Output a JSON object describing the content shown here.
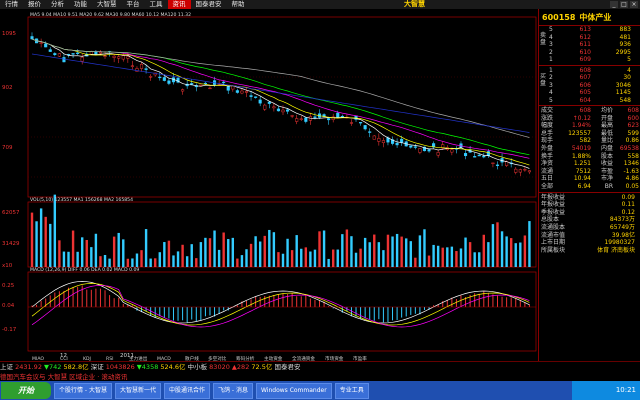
{
  "menu": {
    "items": [
      "行情",
      "报价",
      "分析",
      "功能",
      "大智慧",
      "平台",
      "工具",
      "帮助"
    ],
    "active_item": "资讯",
    "secondary": "国泰君安",
    "brand": "大智慧"
  },
  "window_controls": [
    "_",
    "□",
    "×"
  ],
  "stock": {
    "code": "600158",
    "name": "中体产业"
  },
  "order_book": {
    "ask_label": "卖盘",
    "bid_label": "买盘",
    "asks": [
      {
        "level": "5",
        "price": "613",
        "volume": "883"
      },
      {
        "level": "4",
        "price": "612",
        "volume": "481"
      },
      {
        "level": "3",
        "price": "611",
        "volume": "936"
      },
      {
        "level": "2",
        "price": "610",
        "volume": "2995"
      },
      {
        "level": "1",
        "price": "609",
        "volume": "5"
      }
    ],
    "bids": [
      {
        "level": "1",
        "price": "608",
        "volume": "4"
      },
      {
        "level": "2",
        "price": "607",
        "volume": "30"
      },
      {
        "level": "3",
        "price": "606",
        "volume": "3046"
      },
      {
        "level": "4",
        "price": "605",
        "volume": "1145"
      },
      {
        "level": "5",
        "price": "604",
        "volume": "548"
      }
    ]
  },
  "quote_stats": [
    {
      "k": "成交",
      "v": "608",
      "k2": "均价",
      "v2": "608",
      "c": "red"
    },
    {
      "k": "涨跌",
      "v": "↑0.12",
      "k2": "开盘",
      "v2": "600",
      "c": "red"
    },
    {
      "k": "幅度",
      "v": "1.94%",
      "k2": "最高",
      "v2": "623",
      "c": "red"
    },
    {
      "k": "总手",
      "v": "123557",
      "k2": "最低",
      "v2": "599",
      "c": "yellow"
    },
    {
      "k": "现手",
      "v": "582",
      "k2": "量比",
      "v2": "0.86",
      "c": "yellow"
    },
    {
      "k": "外盘",
      "v": "54019",
      "k2": "内盘",
      "v2": "69538",
      "c": "red"
    },
    {
      "k": "换手",
      "v": "1.88%",
      "k2": "股本",
      "v2": "558",
      "c": "yellow"
    },
    {
      "k": "净资",
      "v": "1.251",
      "k2": "收益",
      "v2": "1346",
      "c": "yellow"
    },
    {
      "k": "流通",
      "v": "7512",
      "k2": "市盈",
      "v2": "-1.63",
      "c": "yellow"
    },
    {
      "k": "五日",
      "v": "10.94",
      "k2": "市净",
      "v2": "4.86",
      "c": "yellow"
    },
    {
      "k": "全部",
      "v": "6.94",
      "k2": "BR",
      "v2": "0.05",
      "c": "yellow"
    }
  ],
  "fund_stats": [
    {
      "k": "年报收益",
      "v": "0.09"
    },
    {
      "k": "年报收益",
      "v": "0.11"
    },
    {
      "k": "季报收益",
      "v": "0.12"
    },
    {
      "k": "总股本",
      "v": "84373万"
    },
    {
      "k": "流通股本",
      "v": "65749万"
    },
    {
      "k": "流通市值",
      "v": "39.98亿"
    },
    {
      "k": "上市日期",
      "v": "19980327"
    },
    {
      "k": "所属板块",
      "v": "体育 济南板块"
    }
  ],
  "chart_panels": {
    "kline": {
      "header": "MA5 9.04 MA10 9.51 MA20 9.62 MA30 9.80 MA60 10.12 MA120 11.32",
      "y_ticks": [
        "1095",
        "902",
        "709"
      ],
      "x_ticks": [
        "12",
        "2011"
      ]
    },
    "volume": {
      "header": "VOL(5,10) 123557 MA1 156268 MA2 165854",
      "y_ticks": [
        "62057",
        "31429",
        "x10"
      ]
    },
    "macd": {
      "header": "MACD (12,26,9) DIFF 0.06 DEA 0.02 MACD 0.09",
      "y_ticks": [
        "0.25",
        "0.04",
        "-0.17"
      ]
    }
  },
  "indicator_tabs": [
    "MIAO",
    "CCI",
    "KDJ",
    "RSI",
    "主力进出",
    "MACD",
    "散户线",
    "多空对比",
    "筹码分析",
    "主动资金",
    "全流通资金",
    "市场资金",
    "市盈率"
  ],
  "ticker": {
    "line1": [
      {
        "t": "上证",
        "c": "white"
      },
      {
        "t": "2431.92",
        "c": "red"
      },
      {
        "t": "▼742",
        "c": "green"
      },
      {
        "t": "582.8亿",
        "c": "yellow"
      },
      {
        "t": "深证",
        "c": "white"
      },
      {
        "t": "1043826",
        "c": "red"
      },
      {
        "t": "▼4358",
        "c": "green"
      },
      {
        "t": "524.6亿",
        "c": "yellow"
      },
      {
        "t": "中小板",
        "c": "white"
      },
      {
        "t": "83020",
        "c": "red"
      },
      {
        "t": "▲282",
        "c": "red"
      },
      {
        "t": "72.5亿",
        "c": "yellow"
      },
      {
        "t": "国泰君安",
        "c": "white"
      }
    ],
    "line2": "德国汽车会议与 大智慧 区域企业 · 滚动资讯"
  },
  "taskbar": {
    "start": "开始",
    "items": [
      "个股行情 - 大智慧",
      "大智慧新一代",
      "中股通讯合作",
      "飞鸽 - 消息",
      "Windows Commander",
      "专业工具"
    ],
    "clock": "10:21"
  }
}
